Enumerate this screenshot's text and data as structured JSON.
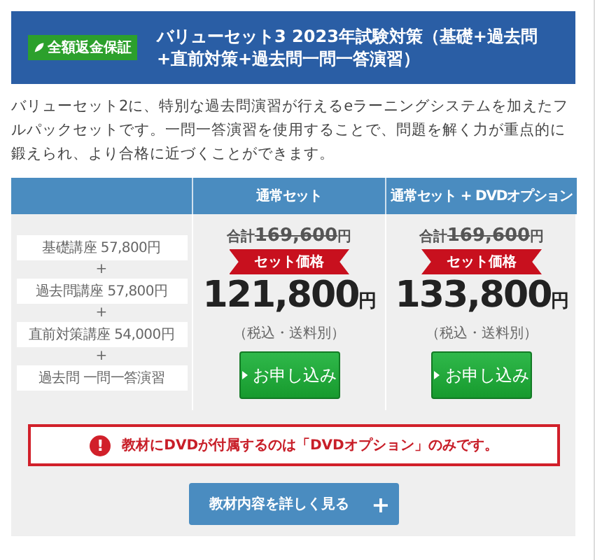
{
  "header": {
    "badge": "全額返金保証",
    "title": "バリューセット3 2023年試験対策（基礎+過去問+直前対策+過去問一問一答演習）"
  },
  "description": "バリューセット2に、特別な過去問演習が行えるeラーニングシステムを加えたフルパックセットです。一問一答演習を使用することで、問題を解く力が重点的に鍛えられ、より合格に近づくことができます。",
  "table": {
    "columns": [
      "通常セット",
      "通常セット + DVDオプション"
    ],
    "courses": [
      "基礎講座 57,800円",
      "過去問講座 57,800円",
      "直前対策講座 54,000円",
      "過去問 一問一答演習"
    ],
    "separator": "+",
    "plans": [
      {
        "total_label": "合計",
        "total": "169,600",
        "total_unit": "円",
        "ribbon": "セット価格",
        "price": "121,800",
        "unit": "円",
        "note": "（税込・送料別）",
        "button": "お申し込み"
      },
      {
        "total_label": "合計",
        "total": "169,600",
        "total_unit": "円",
        "ribbon": "セット価格",
        "price": "133,800",
        "unit": "円",
        "note": "（税込・送料別）",
        "button": "お申し込み"
      }
    ]
  },
  "alert": {
    "icon": "!",
    "text": "教材にDVDが付属するのは「DVDオプション」のみです。"
  },
  "details_button": {
    "label": "教材内容を詳しく見る",
    "icon": "+"
  }
}
